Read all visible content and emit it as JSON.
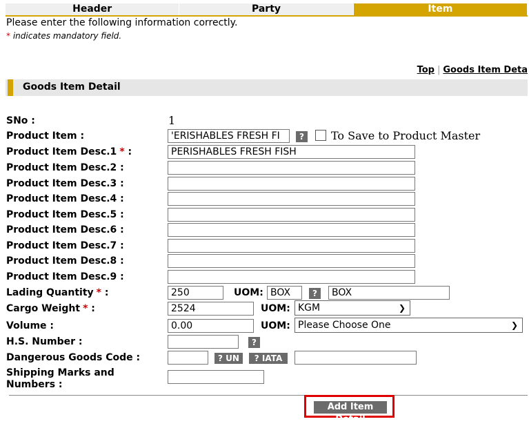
{
  "tabs": [
    "Header",
    "Party",
    "Item"
  ],
  "intro": "Please enter the following information correctly.",
  "mandatory": {
    "star": "*",
    "text": "indicates mandatory field."
  },
  "toplinks": {
    "top": "Top",
    "goods": "Goods Item Deta"
  },
  "section_title": "Goods Item Detail",
  "fields": {
    "sno": {
      "label": "SNo :",
      "value": "1"
    },
    "product_item": {
      "label": "Product Item :",
      "value": "'ERISHABLES FRESH FI",
      "help": "?",
      "checkbox_label": "To Save to Product Master"
    },
    "desc1": {
      "label": "Product Item Desc.1",
      "star": "*",
      "colon": ":",
      "value": "PERISHABLES FRESH FISH"
    },
    "desc2": {
      "label": "Product Item Desc.2 :",
      "value": ""
    },
    "desc3": {
      "label": "Product Item Desc.3 :",
      "value": ""
    },
    "desc4": {
      "label": "Product Item Desc.4 :",
      "value": ""
    },
    "desc5": {
      "label": "Product Item Desc.5 :",
      "value": ""
    },
    "desc6": {
      "label": "Product Item Desc.6 :",
      "value": ""
    },
    "desc7": {
      "label": "Product Item Desc.7 :",
      "value": ""
    },
    "desc8": {
      "label": "Product Item Desc.8 :",
      "value": ""
    },
    "desc9": {
      "label": "Product Item Desc.9 :",
      "value": ""
    },
    "lading_qty": {
      "label": "Lading Quantity",
      "star": "*",
      "colon": ":",
      "value": "250",
      "uom_label": "UOM:",
      "uom_code": "BOX",
      "help": "?",
      "uom_desc": "BOX"
    },
    "cargo_weight": {
      "label": "Cargo Weight",
      "star": "*",
      "colon": ":",
      "value": "2524",
      "uom_label": "UOM:",
      "uom_value": "KGM"
    },
    "volume": {
      "label": "Volume :",
      "value": "0.00",
      "uom_label": "UOM:",
      "uom_value": "Please Choose One"
    },
    "hs_number": {
      "label": "H.S. Number :",
      "value": "",
      "help": "?"
    },
    "dg_code": {
      "label": "Dangerous Goods Code :",
      "value": "",
      "un_btn": "? UN",
      "iata_btn": "? IATA",
      "desc_value": ""
    },
    "shipping_marks": {
      "label_line1": "Shipping Marks and",
      "label_line2": "Numbers :",
      "value": ""
    }
  },
  "add_button": "Add Item Detail",
  "colors": {
    "accent": "#d4a400",
    "button": "#6b6b6b",
    "required": "#d00000",
    "highlight_border": "#e00000"
  }
}
